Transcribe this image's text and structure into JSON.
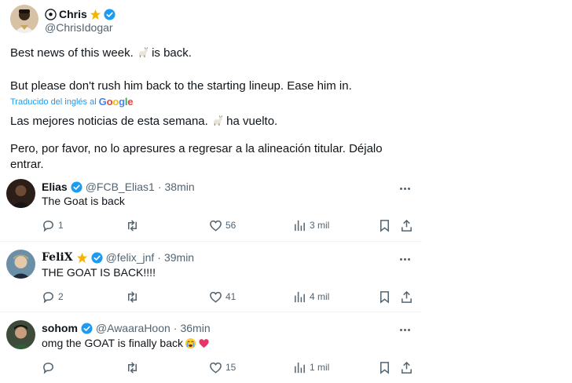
{
  "main_tweet": {
    "author_name": "Chris",
    "author_handle": "@ChrisIdogar",
    "text_1": "Best news of this week.",
    "text_1_tail": "is back.",
    "text_2": "But please don't rush him back to the starting lineup. Ease him in.",
    "translated_label": "Traducido del inglés al",
    "translated_brand": "Google",
    "text_3": "Las mejores noticias de esta semana.",
    "text_3_tail": "ha vuelto.",
    "text_4": "Pero, por favor, no lo apresures a regresar a la alineación titular. Déjalo entrar."
  },
  "replies": [
    {
      "name": "Elias",
      "handle": "@FCB_Elias1",
      "separator": "·",
      "time": "38min",
      "text": "The Goat is back",
      "replies": "1",
      "retweets": "",
      "likes": "56",
      "views": "3 mil"
    },
    {
      "name": "FeliX",
      "handle": "@felix_jnf",
      "separator": "·",
      "time": "39min",
      "text": "THE GOAT IS BACK!!!!",
      "replies": "2",
      "retweets": "",
      "likes": "41",
      "views": "4 mil"
    },
    {
      "name": "sohom",
      "handle": "@AwaaraHoon",
      "separator": "·",
      "time": "36min",
      "text": "omg the GOAT is finally back",
      "replies": "",
      "retweets": "",
      "likes": "15",
      "views": "1 mil"
    }
  ],
  "colors": {
    "link_blue": "#1d9bf0",
    "secondary_text": "#536471",
    "verified_badge": "#1d9bf0",
    "star": "#f4b400",
    "separator": "#eff3f4"
  },
  "icons": {
    "reply": "reply-icon",
    "retweet": "retweet-icon",
    "like": "heart-icon",
    "views": "views-icon",
    "bookmark": "bookmark-icon",
    "share": "share-icon",
    "more": "more-icon"
  }
}
